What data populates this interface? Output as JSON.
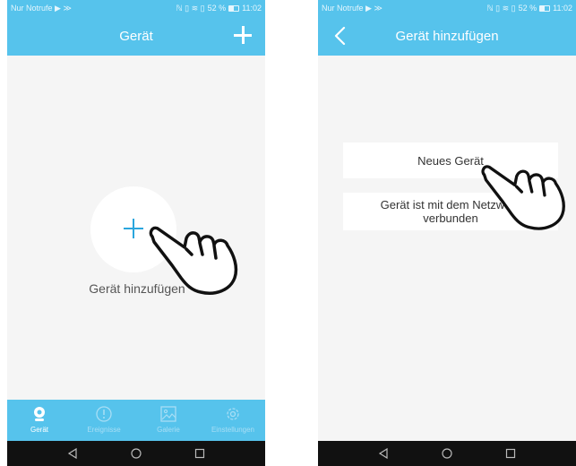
{
  "status_bar": {
    "carrier": "Nur Notrufe",
    "battery": "52 %",
    "time": "11:02"
  },
  "screen_left": {
    "title": "Gerät",
    "add_label": "Gerät hinzufügen",
    "tabs": [
      {
        "label": "Gerät",
        "icon": "camera-icon",
        "active": true
      },
      {
        "label": "Ereignisse",
        "icon": "alert-icon",
        "active": false
      },
      {
        "label": "Galerie",
        "icon": "gallery-icon",
        "active": false
      },
      {
        "label": "Einstellungen",
        "icon": "gear-icon",
        "active": false
      }
    ]
  },
  "screen_right": {
    "title": "Gerät hinzufügen",
    "option_new": "Neues Gerät",
    "option_network_line1": "Gerät ist mit dem Netzwerk",
    "option_network_line2": "verbunden"
  },
  "colors": {
    "accent": "#56c3ec",
    "plus": "#2aa6dd",
    "nav": "#111111"
  }
}
